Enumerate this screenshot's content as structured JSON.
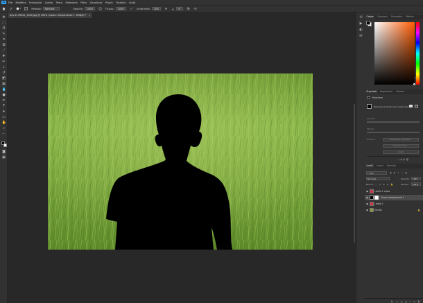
{
  "menu": {
    "logo": "Ps",
    "items": [
      "File",
      "Modifica",
      "Immagine",
      "Livello",
      "Testo",
      "Selezione",
      "Filtro",
      "Visualizza",
      "Plugin",
      "Finestra",
      "Aiuto"
    ]
  },
  "options": {
    "mode_label": "Metodo:",
    "mode_value": "Normale",
    "opacity_label": "Opacità:",
    "opacity_value": "100%",
    "flow_label": "Flusso:",
    "flow_value": "100%",
    "smoothing_label": "Uniformità:",
    "smoothing_value": "10%",
    "angle_value": "0°"
  },
  "document": {
    "tab_title": "boy-2176341_1280.jpg @ 100% (Colore riempimento 1, RGB/8) *",
    "close_glyph": "×"
  },
  "color_panel": {
    "tabs": [
      "Colore",
      "Campioni",
      "Sfumature",
      "Pattern"
    ],
    "hue_color": "#ff5a00"
  },
  "properties_panel": {
    "tabs": [
      "Proprietà",
      "Regolazioni",
      "Librerie"
    ],
    "section_label": "Maschere",
    "selected_label": "Maschera di livello pixel selezionata",
    "density_label": "Densità:",
    "feather_label": "Sfuma:",
    "refine_label": "Rifinisci:",
    "select_mask_button": "Seleziona e maschera...",
    "color_range_button": "Intervallo colori...",
    "invert_button": "Inverti"
  },
  "layers_panel": {
    "tabs": [
      "Livelli",
      "Canali",
      "Tracciati"
    ],
    "filter_label": "Tipo",
    "blend_mode": "Normale",
    "opacity_label": "Opacità:",
    "opacity_value": "100%",
    "lock_label": "Blocca:",
    "fill_label": "Riempi.:",
    "fill_value": "100%",
    "layers": [
      {
        "name": "Livello 1 copia",
        "selected": false,
        "thumb": "#cc3344"
      },
      {
        "name": "Colore riempimento 1",
        "selected": true,
        "thumb": "#000000"
      },
      {
        "name": "Livello 1",
        "selected": false,
        "thumb": "#cc3344"
      },
      {
        "name": "Sfondo",
        "selected": false,
        "thumb": "#8a9a3a"
      }
    ]
  },
  "colors": {
    "ui_dark": "#323232",
    "pasteboard": "#282828",
    "accent": "#31a8ff",
    "grass": "#7fa83a"
  }
}
